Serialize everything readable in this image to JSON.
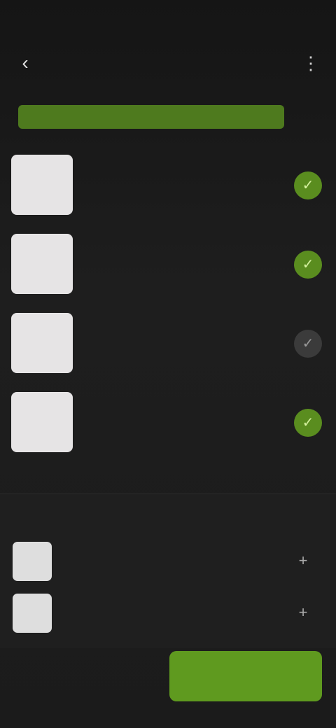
{
  "status_bar": {
    "time": "",
    "system": ""
  },
  "header": {
    "title": ""
  },
  "banner": {
    "text": ""
  },
  "items": [
    {
      "name": "",
      "qty": "",
      "selected": true
    },
    {
      "name": "",
      "qty": "",
      "selected": true
    },
    {
      "name": "",
      "qty": "",
      "selected": false
    },
    {
      "name": "",
      "qty": "",
      "selected": true
    }
  ],
  "recommendations": {
    "label": "",
    "rows": [
      {
        "name": ""
      },
      {
        "name": ""
      }
    ]
  },
  "footer": {
    "total_text": "",
    "cta_label": ""
  },
  "colors": {
    "accent": "#5f9a1f",
    "background": "#1b1b1b"
  },
  "icons": {
    "back": "chevron-left-icon",
    "menu": "menu-icon",
    "check": "check-icon",
    "plus": "plus-icon"
  }
}
